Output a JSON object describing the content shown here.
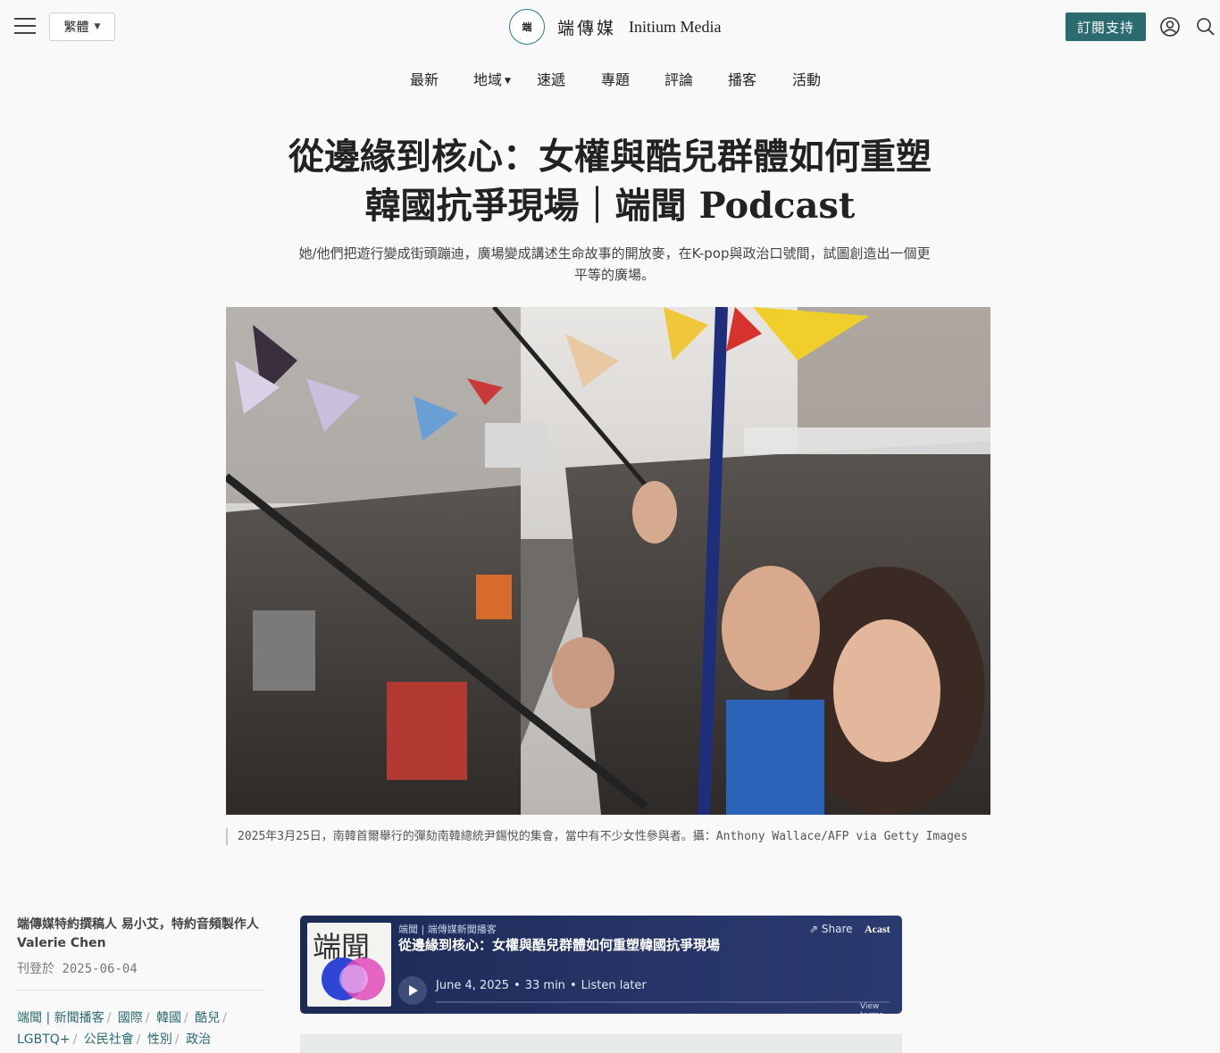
{
  "header": {
    "language_label": "繁體",
    "logo_cn": "端傳媒",
    "logo_en": "Initium Media",
    "logo_mark": "端",
    "subscribe_label": "訂閱支持"
  },
  "nav": {
    "items": [
      "最新",
      "地域",
      "速遞",
      "專題",
      "評論",
      "播客",
      "活動"
    ]
  },
  "article": {
    "title_line1": "從邊緣到核心：女權與酷兒群體如何重塑",
    "title_line2": "韓國抗爭現場｜端聞 Podcast",
    "subtitle": "她/他們把遊行變成街頭蹦迪，廣場變成講述生命故事的開放麥，在K-pop與政治口號間，試圖創造出一個更平等的廣場。",
    "caption": "2025年3月25日，南韓首爾舉行的彈劾南韓總統尹錫悅的集會，當中有不少女性參與者。攝：Anthony Wallace/AFP via Getty Images"
  },
  "sidebar": {
    "author": "端傳媒特約撰稿人 易小艾，特約音頻製作人 Valerie Chen",
    "pubdate_label": "刊登於",
    "pubdate": "2025-06-04",
    "tags": [
      "端聞 | 新聞播客",
      "國際",
      "韓國",
      "酷兒",
      "LGBTQ+",
      "公民社會",
      "性別",
      "政治"
    ]
  },
  "player": {
    "art_text": "端聞",
    "show": "端聞 | 端傳媒新聞播客",
    "title": "從邊緣到核心：女權與酷兒群體如何重塑韓國抗爭現場",
    "share": "Share",
    "brand": "Acast",
    "date": "June 4, 2025",
    "duration": "33 min",
    "listen_later": "Listen later",
    "terms": "View terms"
  },
  "colors": {
    "accent": "#2b6a6f",
    "player_bg": "#1c2a55"
  }
}
